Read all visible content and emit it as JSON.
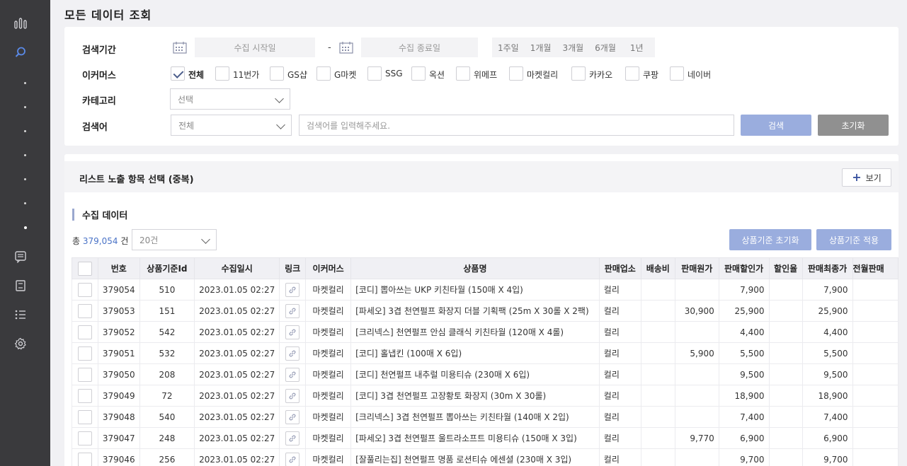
{
  "page_title": "모든 데이터 조회",
  "search": {
    "period_label": "검색기간",
    "start_placeholder": "수집 시작일",
    "end_placeholder": "수집 종료일",
    "dash": "-",
    "periods": [
      "1주일",
      "1개월",
      "3개월",
      "6개월",
      "1년"
    ],
    "ecommerce_label": "이커머스",
    "ecommerce_options": [
      {
        "label": "전체",
        "checked": true
      },
      {
        "label": "11번가",
        "checked": false
      },
      {
        "label": "GS샵",
        "checked": false
      },
      {
        "label": "G마켓",
        "checked": false
      },
      {
        "label": "SSG",
        "checked": false
      },
      {
        "label": "옥션",
        "checked": false
      },
      {
        "label": "위메프",
        "checked": false
      },
      {
        "label": "마켓컬리",
        "checked": false
      },
      {
        "label": "카카오",
        "checked": false
      },
      {
        "label": "쿠팡",
        "checked": false
      },
      {
        "label": "네이버",
        "checked": false
      }
    ],
    "category_label": "카테고리",
    "category_value": "선택",
    "keyword_label": "검색어",
    "keyword_scope": "전체",
    "keyword_placeholder": "검색어를 입력해주세요.",
    "search_button": "검색",
    "reset_button": "초기화"
  },
  "list": {
    "header_title": "리스트 노출 항목 선택 (중복)",
    "view_button": "보기",
    "section_title": "수집 데이터",
    "total_prefix": "총",
    "total_count": "379,054",
    "total_suffix": "건",
    "page_size": "20건",
    "reset_basis_button": "상품기준 초기화",
    "apply_basis_button": "상품기준 적용",
    "columns": [
      "번호",
      "상품기준Id",
      "수집일시",
      "링크",
      "이커머스",
      "상품명",
      "판매업소",
      "배송비",
      "판매원가",
      "판매할인가",
      "할인율",
      "판매최종가",
      "전월판매"
    ],
    "rows": [
      {
        "no": "379054",
        "basis_id": "510",
        "collected": "2023.01.05 02:27",
        "ecommerce": "마켓컬리",
        "name": "[코디] 뽑아쓰는 UKP 키친타월 (150매 X 4입)",
        "seller": "컬리",
        "shipping": "",
        "original": "",
        "discount_price": "7,900",
        "rate": "",
        "final": "7,900",
        "prev": ""
      },
      {
        "no": "379053",
        "basis_id": "151",
        "collected": "2023.01.05 02:27",
        "ecommerce": "마켓컬리",
        "name": "[파세오] 3겹 천연펄프 화장지 더블 기획팩 (25m X 30롤 X 2팩)",
        "seller": "컬리",
        "shipping": "",
        "original": "30,900",
        "discount_price": "25,900",
        "rate": "",
        "final": "25,900",
        "prev": ""
      },
      {
        "no": "379052",
        "basis_id": "542",
        "collected": "2023.01.05 02:27",
        "ecommerce": "마켓컬리",
        "name": "[크리넥스] 천연펄프 안심 클래식 키친타월 (120매 X 4롤)",
        "seller": "컬리",
        "shipping": "",
        "original": "",
        "discount_price": "4,400",
        "rate": "",
        "final": "4,400",
        "prev": ""
      },
      {
        "no": "379051",
        "basis_id": "532",
        "collected": "2023.01.05 02:27",
        "ecommerce": "마켓컬리",
        "name": "[코디] 홀냅킨 (100매 X 6입)",
        "seller": "컬리",
        "shipping": "",
        "original": "5,900",
        "discount_price": "5,500",
        "rate": "",
        "final": "5,500",
        "prev": ""
      },
      {
        "no": "379050",
        "basis_id": "208",
        "collected": "2023.01.05 02:27",
        "ecommerce": "마켓컬리",
        "name": "[코디] 천연펄프 내추럴 미용티슈 (230매 X 6입)",
        "seller": "컬리",
        "shipping": "",
        "original": "",
        "discount_price": "9,500",
        "rate": "",
        "final": "9,500",
        "prev": ""
      },
      {
        "no": "379049",
        "basis_id": "72",
        "collected": "2023.01.05 02:27",
        "ecommerce": "마켓컬리",
        "name": "[코디] 3겹 천연펄프 고장황토 화장지 (30m X 30롤)",
        "seller": "컬리",
        "shipping": "",
        "original": "",
        "discount_price": "18,900",
        "rate": "",
        "final": "18,900",
        "prev": ""
      },
      {
        "no": "379048",
        "basis_id": "540",
        "collected": "2023.01.05 02:27",
        "ecommerce": "마켓컬리",
        "name": "[크리넥스] 3겹 천연펄프 뽑아쓰는 키친타월 (140매 X 2입)",
        "seller": "컬리",
        "shipping": "",
        "original": "",
        "discount_price": "7,400",
        "rate": "",
        "final": "7,400",
        "prev": ""
      },
      {
        "no": "379047",
        "basis_id": "248",
        "collected": "2023.01.05 02:27",
        "ecommerce": "마켓컬리",
        "name": "[파세오] 3겹 천연펄프 울트라소프트 미용티슈 (150매 X 3입)",
        "seller": "컬리",
        "shipping": "",
        "original": "9,770",
        "discount_price": "6,900",
        "rate": "",
        "final": "6,900",
        "prev": ""
      },
      {
        "no": "379046",
        "basis_id": "256",
        "collected": "2023.01.05 02:27",
        "ecommerce": "마켓컬리",
        "name": "[잘풀리는집] 천연펄프 명품 로션티슈 에센셜 (230매 X 3입)",
        "seller": "컬리",
        "shipping": "",
        "original": "",
        "discount_price": "9,700",
        "rate": "",
        "final": "9,700",
        "prev": ""
      }
    ]
  },
  "colors": {
    "accent": "#9aadde",
    "link": "#4a73c7",
    "sidebar": "#3a3a3d",
    "reset": "#909090"
  }
}
